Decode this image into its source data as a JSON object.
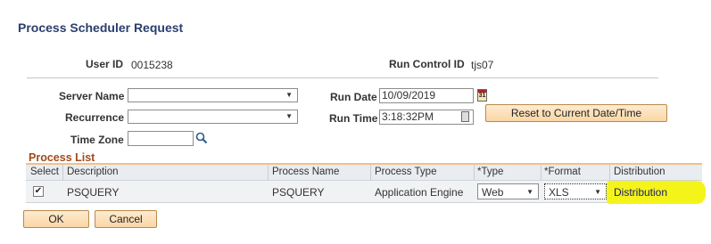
{
  "page": {
    "title": "Process Scheduler Request"
  },
  "header": {
    "user_id_label": "User ID",
    "user_id_value": "0015238",
    "run_control_label": "Run Control ID",
    "run_control_value": "tjs07"
  },
  "form": {
    "server_name_label": "Server Name",
    "server_name_value": "",
    "recurrence_label": "Recurrence",
    "recurrence_value": "",
    "time_zone_label": "Time Zone",
    "time_zone_value": "",
    "run_date_label": "Run Date",
    "run_date_value": "10/09/2019",
    "calendar_icon_text": "31",
    "run_time_label": "Run Time",
    "run_time_value": "3:18:32PM",
    "reset_button_label": "Reset to Current Date/Time"
  },
  "process_list": {
    "title": "Process List",
    "columns": [
      "Select",
      "Description",
      "Process Name",
      "Process Type",
      "*Type",
      "*Format",
      "Distribution"
    ],
    "rows": [
      {
        "selected": true,
        "checkmark": "✔",
        "description": "PSQUERY",
        "process_name": "PSQUERY",
        "process_type": "Application Engine",
        "type": "Web",
        "format": "XLS",
        "distribution": "Distribution"
      }
    ]
  },
  "footer": {
    "ok_label": "OK",
    "cancel_label": "Cancel"
  },
  "colors": {
    "title": "#2a3f6e",
    "process_list_title": "#a34a1a",
    "button_bg": "#fad6a5",
    "highlight": "#f4f41a"
  },
  "icons": {
    "search": "search-icon",
    "calendar": "calendar-icon",
    "time_stepper": "clock-stepper-icon",
    "dropdown": "chevron-down-icon"
  }
}
